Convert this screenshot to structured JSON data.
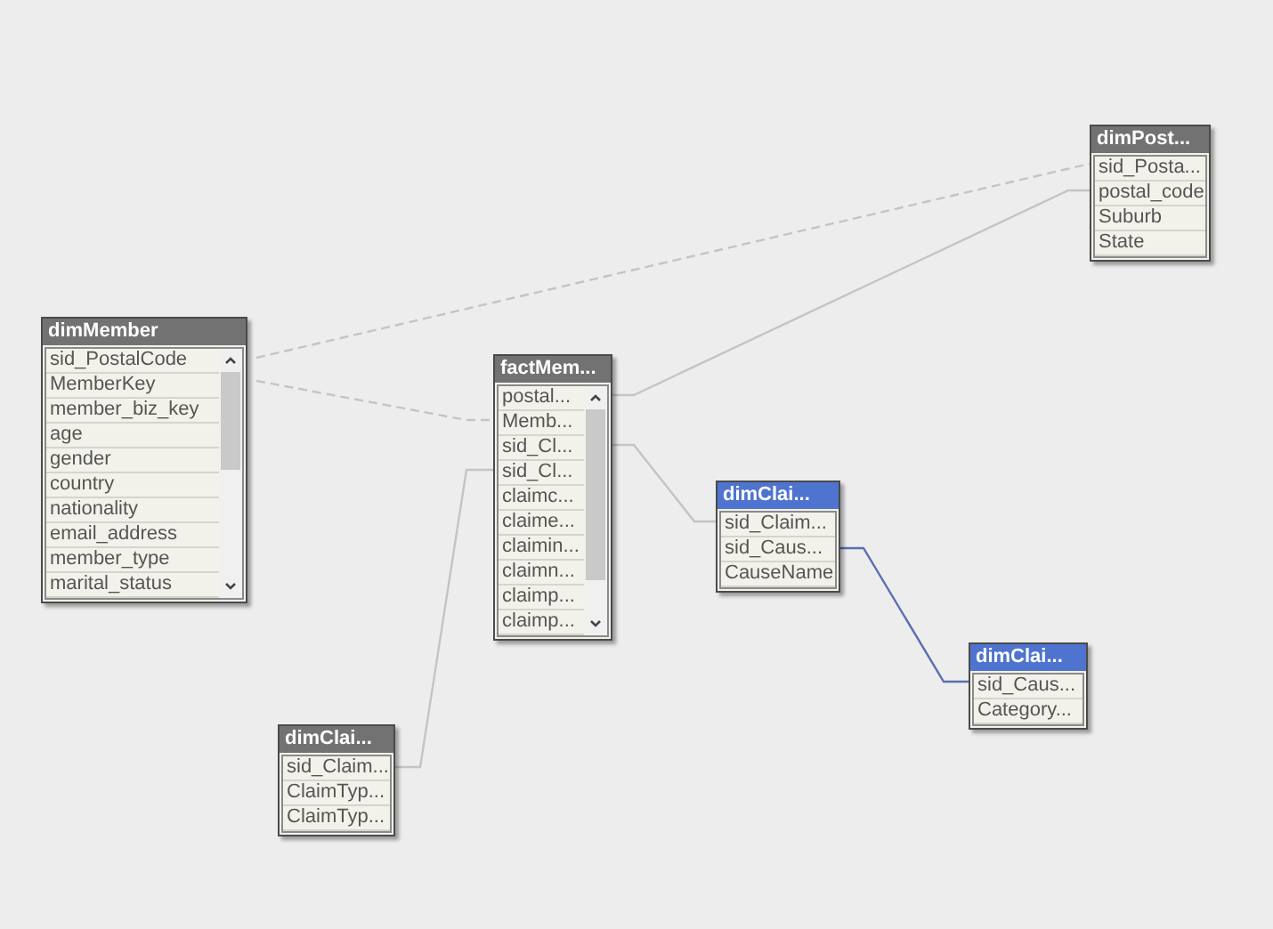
{
  "tables": [
    {
      "title": "dimMember",
      "selected": false,
      "scrollbar": true,
      "fields": [
        "sid_PostalCode",
        "MemberKey",
        "member_biz_key",
        "age",
        "gender",
        "country",
        "nationality",
        "email_address",
        "member_type",
        "marital_status"
      ]
    },
    {
      "title": "factMem...",
      "selected": false,
      "scrollbar": true,
      "fields": [
        "postal...",
        "Memb...",
        "sid_Cl...",
        "sid_Cl...",
        "claimc...",
        "claime...",
        "claimin...",
        "claimn...",
        "claimp...",
        "claimp..."
      ]
    },
    {
      "title": "dimPost...",
      "selected": false,
      "scrollbar": false,
      "fields": [
        "sid_Posta...",
        "postal_code",
        "Suburb",
        "State"
      ]
    },
    {
      "title": "dimClai...",
      "selected": true,
      "scrollbar": false,
      "fields": [
        "sid_Claim...",
        "sid_Caus...",
        "CauseName"
      ]
    },
    {
      "title": "dimClai...",
      "selected": true,
      "scrollbar": false,
      "fields": [
        "sid_Caus...",
        "Category..."
      ]
    },
    {
      "title": "dimClai...",
      "selected": false,
      "scrollbar": false,
      "fields": [
        "sid_Claim...",
        "ClaimTyp...",
        "ClaimTyp..."
      ]
    }
  ]
}
